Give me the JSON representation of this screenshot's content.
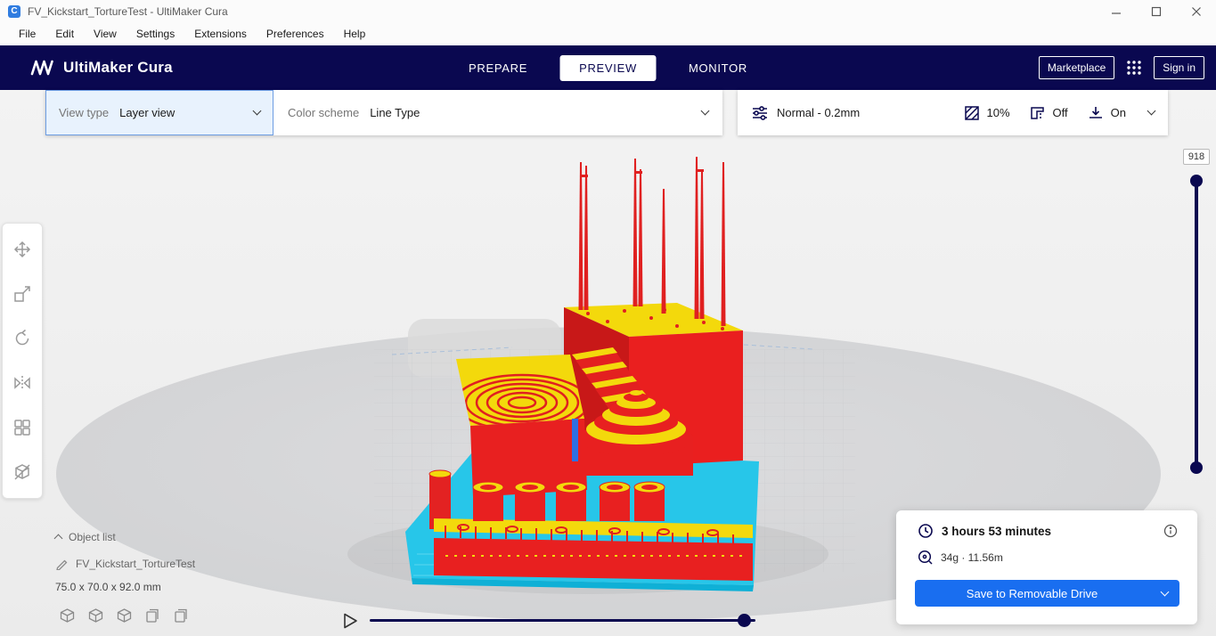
{
  "window": {
    "title": "FV_Kickstart_TortureTest - UltiMaker Cura",
    "app_letter": "C"
  },
  "menu": {
    "items": [
      "File",
      "Edit",
      "View",
      "Settings",
      "Extensions",
      "Preferences",
      "Help"
    ]
  },
  "header": {
    "brand": "UltiMaker Cura",
    "stages": [
      {
        "label": "PREPARE",
        "active": false
      },
      {
        "label": "PREVIEW",
        "active": true
      },
      {
        "label": "MONITOR",
        "active": false
      }
    ],
    "marketplace_label": "Marketplace",
    "sign_in_label": "Sign in"
  },
  "view_toolbar": {
    "view_type_label": "View type",
    "view_type_value": "Layer view",
    "color_scheme_label": "Color scheme",
    "color_scheme_value": "Line Type"
  },
  "print_settings_bar": {
    "profile": "Normal - 0.2mm",
    "infill": "10%",
    "support": "Off",
    "adhesion": "On"
  },
  "left_toolbar": {
    "tools": [
      "move",
      "scale",
      "rotate",
      "mirror",
      "per-model-settings",
      "support-blocker"
    ]
  },
  "layer_slider": {
    "max_label": "918"
  },
  "object_panel": {
    "object_list_label": "Object list",
    "object_name": "FV_Kickstart_TortureTest",
    "dimensions": "75.0 x 70.0 x 92.0 mm"
  },
  "print_summary": {
    "time": "3 hours 53 minutes",
    "material": "34g · 11.56m",
    "save_button_label": "Save to Removable Drive"
  },
  "colors": {
    "accent_blue": "#196ef0",
    "header_navy": "#0a0850",
    "model_red": "#e81f1f",
    "model_yellow": "#f3d90c",
    "brim_cyan": "#27c6e9",
    "build_plate_gray": "#d6d6d8"
  }
}
